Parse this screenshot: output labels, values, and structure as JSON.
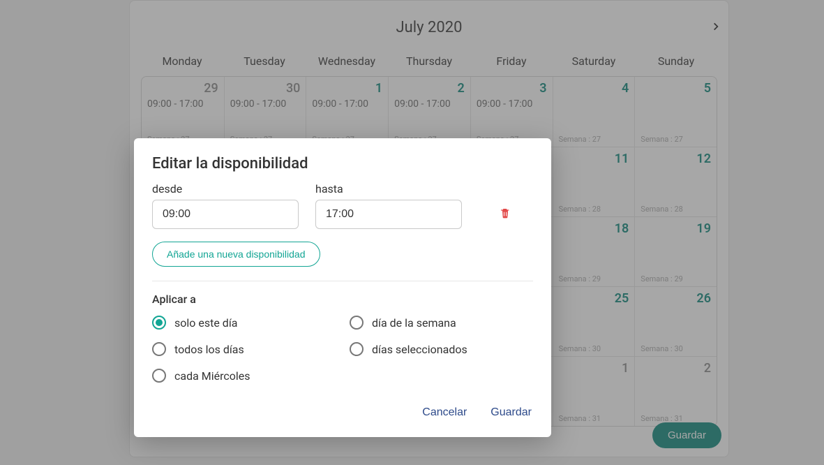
{
  "calendar": {
    "title": "July 2020",
    "dow": [
      "Monday",
      "Tuesday",
      "Wednesday",
      "Thursday",
      "Friday",
      "Saturday",
      "Sunday"
    ],
    "save_label": "Guardar",
    "weeks": [
      [
        {
          "n": "29",
          "cur": false,
          "slot": "09:00 - 17:00",
          "wk": "Semana : 27"
        },
        {
          "n": "30",
          "cur": false,
          "slot": "09:00 - 17:00",
          "wk": "Semana : 27"
        },
        {
          "n": "1",
          "cur": true,
          "slot": "09:00 - 17:00",
          "wk": "Semana : 27"
        },
        {
          "n": "2",
          "cur": true,
          "slot": "09:00 - 17:00",
          "wk": "Semana : 27"
        },
        {
          "n": "3",
          "cur": true,
          "slot": "09:00 - 17:00",
          "wk": "Semana : 27"
        },
        {
          "n": "4",
          "cur": true,
          "slot": "",
          "wk": "Semana : 27"
        },
        {
          "n": "5",
          "cur": true,
          "slot": "",
          "wk": "Semana : 27"
        }
      ],
      [
        {
          "n": "",
          "cur": true,
          "slot": "",
          "wk": ""
        },
        {
          "n": "",
          "cur": true,
          "slot": "",
          "wk": ""
        },
        {
          "n": "",
          "cur": true,
          "slot": "",
          "wk": ""
        },
        {
          "n": "",
          "cur": true,
          "slot": "",
          "wk": ""
        },
        {
          "n": "",
          "cur": true,
          "slot": "",
          "wk": ""
        },
        {
          "n": "11",
          "cur": true,
          "slot": "",
          "wk": "Semana : 28"
        },
        {
          "n": "12",
          "cur": true,
          "slot": "",
          "wk": "Semana : 28"
        }
      ],
      [
        {
          "n": "",
          "cur": true,
          "slot": "",
          "wk": ""
        },
        {
          "n": "",
          "cur": true,
          "slot": "",
          "wk": ""
        },
        {
          "n": "",
          "cur": true,
          "slot": "",
          "wk": ""
        },
        {
          "n": "",
          "cur": true,
          "slot": "",
          "wk": ""
        },
        {
          "n": "",
          "cur": true,
          "slot": "",
          "wk": ""
        },
        {
          "n": "18",
          "cur": true,
          "slot": "",
          "wk": "Semana : 29"
        },
        {
          "n": "19",
          "cur": true,
          "slot": "",
          "wk": "Semana : 29"
        }
      ],
      [
        {
          "n": "",
          "cur": true,
          "slot": "",
          "wk": ""
        },
        {
          "n": "",
          "cur": true,
          "slot": "",
          "wk": ""
        },
        {
          "n": "",
          "cur": true,
          "slot": "",
          "wk": ""
        },
        {
          "n": "",
          "cur": true,
          "slot": "",
          "wk": ""
        },
        {
          "n": "",
          "cur": true,
          "slot": "",
          "wk": ""
        },
        {
          "n": "25",
          "cur": true,
          "slot": "",
          "wk": "Semana : 30"
        },
        {
          "n": "26",
          "cur": true,
          "slot": "",
          "wk": "Semana : 30"
        }
      ],
      [
        {
          "n": "",
          "cur": true,
          "slot": "",
          "wk": ""
        },
        {
          "n": "",
          "cur": true,
          "slot": "",
          "wk": ""
        },
        {
          "n": "",
          "cur": true,
          "slot": "",
          "wk": ""
        },
        {
          "n": "",
          "cur": true,
          "slot": "",
          "wk": ""
        },
        {
          "n": "",
          "cur": true,
          "slot": "",
          "wk": ""
        },
        {
          "n": "1",
          "cur": false,
          "slot": "",
          "wk": "Semana : 31"
        },
        {
          "n": "2",
          "cur": false,
          "slot": "",
          "wk": "Semana : 31"
        }
      ]
    ]
  },
  "modal": {
    "title": "Editar la disponibilidad",
    "from_label": "desde",
    "to_label": "hasta",
    "from_value": "09:00",
    "to_value": "17:00",
    "add_label": "Añade una nueva disponibilidad",
    "apply_title": "Aplicar a",
    "options": [
      {
        "label": "solo este día",
        "selected": true
      },
      {
        "label": "día de la semana",
        "selected": false
      },
      {
        "label": "todos los días",
        "selected": false
      },
      {
        "label": "días seleccionados",
        "selected": false
      },
      {
        "label": "cada Miércoles",
        "selected": false
      }
    ],
    "cancel_label": "Cancelar",
    "save_label": "Guardar"
  }
}
